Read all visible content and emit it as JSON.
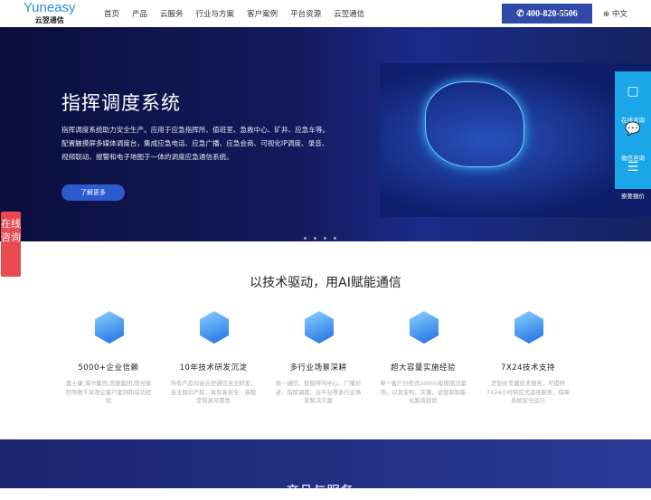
{
  "header": {
    "logo_en": "Yuneasy",
    "logo_cn": "云翌通信",
    "nav": [
      "首页",
      "产品",
      "云服务",
      "行业与方案",
      "客户案例",
      "平台资源",
      "云翌通信"
    ],
    "phone": "400-820-5506",
    "lang": "中文"
  },
  "hero": {
    "title": "指挥调度系统",
    "desc": "指挥调度系统助力安全生产。应用于应急指挥所、值班室、急救中心、矿井、应急车等。配置触摸屏多媒体调度台，集成应急电话、应急广播、应急会商、可视化IP调度、录音、视频联动、报警和电子地图于一体的调度应急通信系统。",
    "button": "了解更多"
  },
  "side": [
    {
      "label": "在线咨询",
      "icon": "chat-bubble-icon"
    },
    {
      "label": "微信咨询",
      "icon": "wechat-icon"
    },
    {
      "label": "索要报价",
      "icon": "user-list-icon"
    }
  ],
  "online": "在线咨询",
  "section": {
    "title": "以技术驱动，用AI赋能通信",
    "features": [
      {
        "title": "5000+企业信赖",
        "desc": "富士康,海尔集团,百联集团,阳光保险等数千家政企客户案例和成功经验"
      },
      {
        "title": "10年技术研发沉淀",
        "desc": "所有产品均由云翌通信自主研发，自主知识产权，具有高安全、高稳定和高可靠性"
      },
      {
        "title": "多行业场景深耕",
        "desc": "统一通信、智能呼叫中心、广播对讲、指挥调度、云平台等多行业场景解决方案"
      },
      {
        "title": "超大容量实施经验",
        "desc": "单一客户分布式20000座席成功案例，以及架构、实施、运营和智能化集成经验"
      },
      {
        "title": "7X24技术支持",
        "desc": "定制化专属技术服务，可提供7X24小时响应式运维服务，保障系统安全运行"
      }
    ]
  },
  "bottom": {
    "title": "产品与服务"
  }
}
